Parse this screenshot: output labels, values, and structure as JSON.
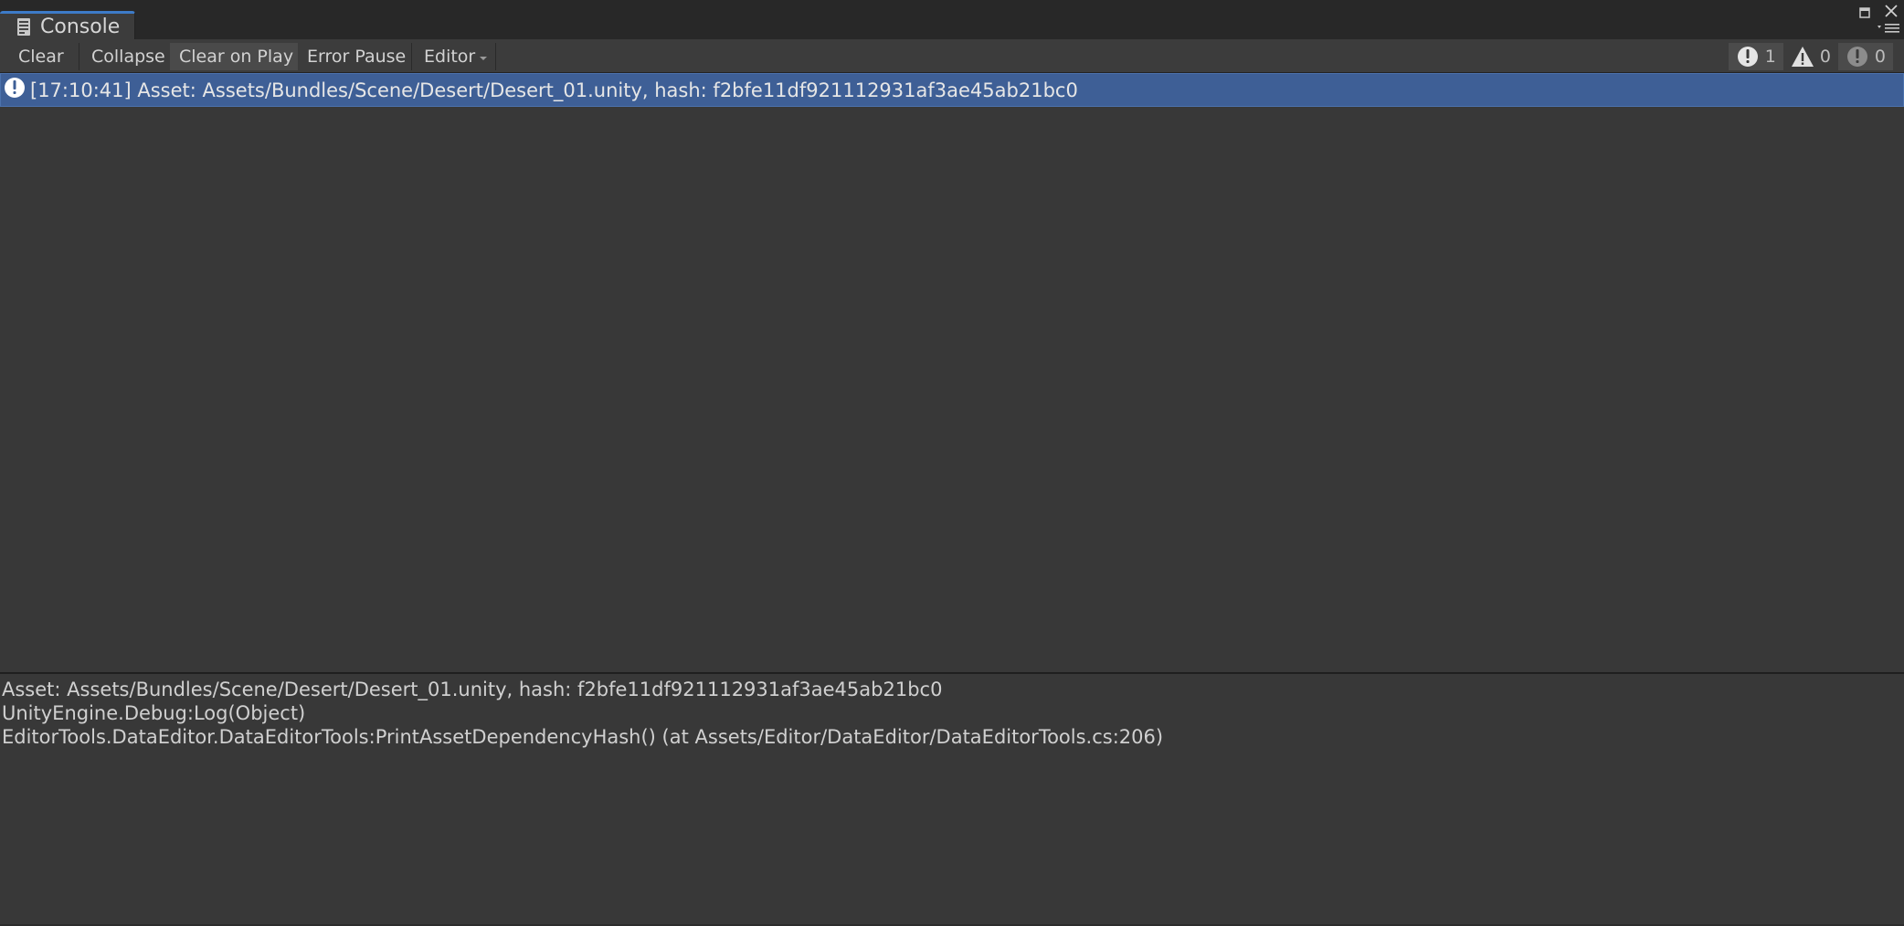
{
  "tab": {
    "title": "Console"
  },
  "toolbar": {
    "clear_label": "Clear",
    "collapse_label": "Collapse",
    "clear_on_play_label": "Clear on Play",
    "error_pause_label": "Error Pause",
    "editor_label": "Editor"
  },
  "counters": {
    "info": "1",
    "warnings": "0",
    "errors": "0"
  },
  "log": {
    "entries": [
      {
        "message": "[17:10:41] Asset: Assets/Bundles/Scene/Desert/Desert_01.unity, hash: f2bfe11df921112931af3ae45ab21bc0",
        "selected": true,
        "icon": "info-icon"
      }
    ]
  },
  "detail": {
    "lines": [
      "Asset: Assets/Bundles/Scene/Desert/Desert_01.unity, hash: f2bfe11df921112931af3ae45ab21bc0",
      "UnityEngine.Debug:Log(Object)",
      "EditorTools.DataEditor.DataEditorTools:PrintAssetDependencyHash() (at Assets/Editor/DataEditor/DataEditorTools.cs:206)"
    ]
  },
  "colors": {
    "accent": "#3d7bc8",
    "selection": "#3e5f96",
    "background": "#383838"
  }
}
